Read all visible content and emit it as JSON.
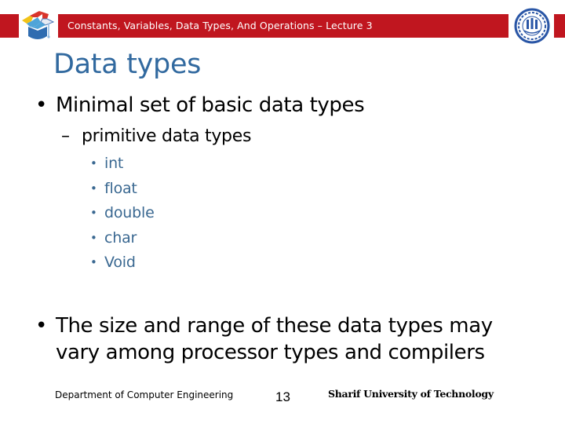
{
  "header": {
    "title": "Constants, Variables, Data Types, And Operations – Lecture 3",
    "left_logo_icon": "graduation-cap-puzzle-logo",
    "right_logo_icon": "university-seal-logo",
    "accent_color": "#c0161f"
  },
  "slide": {
    "title": "Data types",
    "title_color": "#31699f",
    "bullets": [
      {
        "text": "Minimal set of basic data types",
        "sub": {
          "text": "primitive data types",
          "items": [
            "int",
            "float",
            "double",
            "char",
            "Void"
          ]
        }
      },
      {
        "text_line1": "The size and range of these data types may",
        "text_line2": "vary among processor types and compilers"
      }
    ],
    "bullet_glyph": "•",
    "dash_glyph": "–"
  },
  "footer": {
    "department": "Department of Computer Engineering",
    "page_number": "13",
    "university": "Sharif University of Technology"
  }
}
